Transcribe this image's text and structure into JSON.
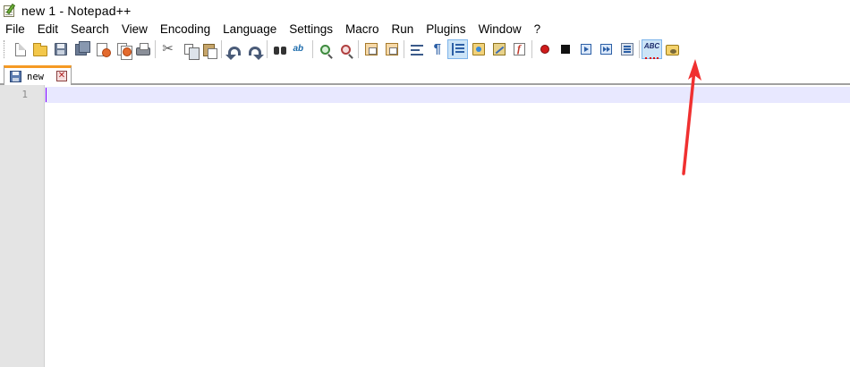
{
  "window": {
    "title": "new  1 - Notepad++"
  },
  "menu": {
    "items": [
      "File",
      "Edit",
      "Search",
      "View",
      "Encoding",
      "Language",
      "Settings",
      "Macro",
      "Run",
      "Plugins",
      "Window",
      "?"
    ]
  },
  "toolbar": {
    "buttons": [
      {
        "icon": "new-file-icon"
      },
      {
        "icon": "open-file-icon"
      },
      {
        "icon": "save-icon"
      },
      {
        "icon": "save-all-icon"
      },
      {
        "icon": "close-icon"
      },
      {
        "icon": "close-all-icon"
      },
      {
        "icon": "print-icon"
      },
      {
        "icon": "cut-icon"
      },
      {
        "icon": "copy-icon"
      },
      {
        "icon": "paste-icon"
      },
      {
        "icon": "undo-icon"
      },
      {
        "icon": "redo-icon"
      },
      {
        "icon": "find-icon"
      },
      {
        "icon": "replace-icon"
      },
      {
        "icon": "zoom-in-icon"
      },
      {
        "icon": "zoom-out-icon"
      },
      {
        "icon": "sync-vertical-scroll-icon"
      },
      {
        "icon": "sync-horizontal-scroll-icon"
      },
      {
        "icon": "word-wrap-icon"
      },
      {
        "icon": "show-all-characters-icon"
      },
      {
        "icon": "indent-guide-icon",
        "active": true
      },
      {
        "icon": "user-defined-language-icon"
      },
      {
        "icon": "document-map-icon"
      },
      {
        "icon": "function-list-icon"
      },
      {
        "icon": "record-macro-icon"
      },
      {
        "icon": "stop-recording-icon"
      },
      {
        "icon": "playback-macro-icon"
      },
      {
        "icon": "run-macro-multiple-icon"
      },
      {
        "icon": "save-macro-icon"
      },
      {
        "icon": "spell-check-icon",
        "active": true,
        "label": "ABC"
      },
      {
        "icon": "plugin-folder-icon"
      }
    ]
  },
  "tabs": [
    {
      "label": "new",
      "close_label": "✕"
    }
  ],
  "editor": {
    "line_numbers": [
      "1"
    ],
    "content": ""
  },
  "colors": {
    "current_line": "#e8e8ff",
    "gutter": "#e4e4e4",
    "active_tab_accent": "#f59a23",
    "caret": "#8000ff",
    "annotation_arrow": "#f03030"
  }
}
